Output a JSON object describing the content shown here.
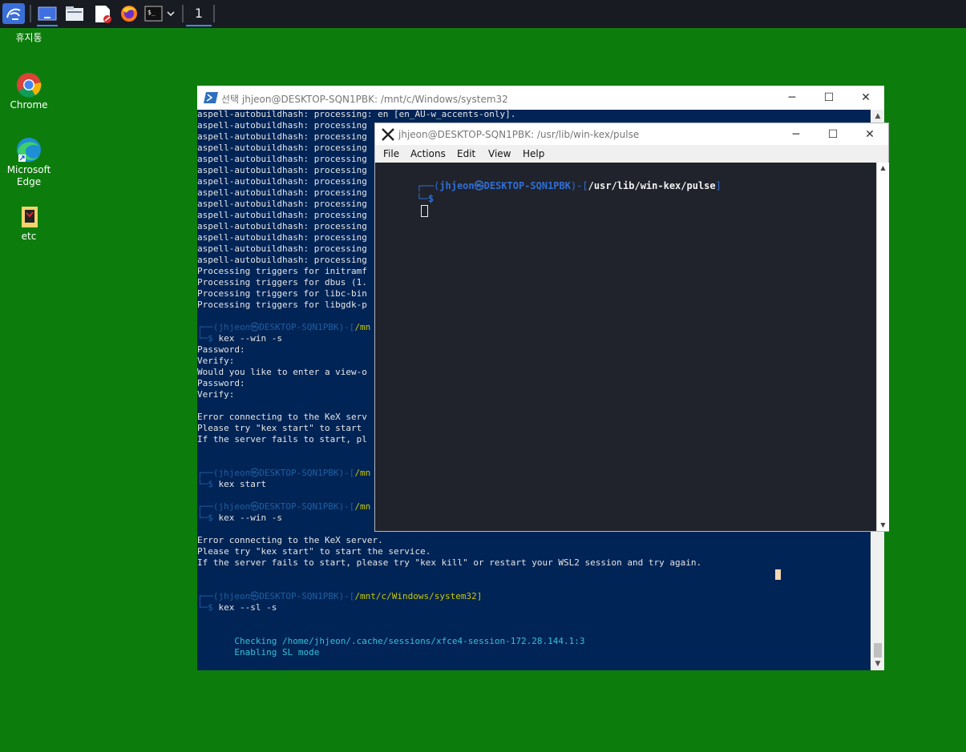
{
  "taskbar": {
    "workspace_number": "1",
    "icons": [
      "kali-menu-icon",
      "desktop-icon",
      "file-manager-icon",
      "text-editor-icon",
      "firefox-icon",
      "terminal-icon"
    ]
  },
  "desktop": {
    "items": [
      {
        "name": "trash",
        "label": "휴지통"
      },
      {
        "name": "chrome",
        "label": "Chrome"
      },
      {
        "name": "edge",
        "label": "Microsoft\nEdge"
      },
      {
        "name": "etc",
        "label": "etc"
      }
    ]
  },
  "ps_window": {
    "title": "선택 jhjeon@DESKTOP-SQN1PBK: /mnt/c/Windows/system32",
    "lines": [
      {
        "t": "aspell-autobuildhash: processing: en [en_AU-w_accents-only]."
      },
      {
        "t": "aspell-autobuildhash: processing"
      },
      {
        "t": "aspell-autobuildhash: processing"
      },
      {
        "t": "aspell-autobuildhash: processing"
      },
      {
        "t": "aspell-autobuildhash: processing"
      },
      {
        "t": "aspell-autobuildhash: processing"
      },
      {
        "t": "aspell-autobuildhash: processing"
      },
      {
        "t": "aspell-autobuildhash: processing"
      },
      {
        "t": "aspell-autobuildhash: processing"
      },
      {
        "t": "aspell-autobuildhash: processing"
      },
      {
        "t": "aspell-autobuildhash: processing"
      },
      {
        "t": "aspell-autobuildhash: processing"
      },
      {
        "t": "aspell-autobuildhash: processing"
      },
      {
        "t": "aspell-autobuildhash: processing"
      },
      {
        "t": "Processing triggers for initramf"
      },
      {
        "t": "Processing triggers for dbus (1."
      },
      {
        "t": "Processing triggers for libc-bin"
      },
      {
        "t": "Processing triggers for libgdk-p"
      },
      {
        "t": ""
      },
      {
        "t": "┌──(jhjeon㉿DESKTOP-SQN1PBK)-[/mn",
        "k": "prompt"
      },
      {
        "t": "└─$ kex --win -s",
        "k": "cmd"
      },
      {
        "t": "Password:"
      },
      {
        "t": "Verify:"
      },
      {
        "t": "Would you like to enter a view-o"
      },
      {
        "t": "Password:"
      },
      {
        "t": "Verify:"
      },
      {
        "t": ""
      },
      {
        "t": "Error connecting to the KeX serv"
      },
      {
        "t": "Please try \"kex start\" to start"
      },
      {
        "t": "If the server fails to start, pl"
      },
      {
        "t": ""
      },
      {
        "t": ""
      },
      {
        "t": "┌──(jhjeon㉿DESKTOP-SQN1PBK)-[/mn",
        "k": "prompt"
      },
      {
        "t": "└─$ kex start",
        "k": "cmd"
      },
      {
        "t": ""
      },
      {
        "t": "┌──(jhjeon㉿DESKTOP-SQN1PBK)-[/mn",
        "k": "prompt"
      },
      {
        "t": "└─$ kex --win -s",
        "k": "cmd"
      },
      {
        "t": ""
      },
      {
        "t": "Error connecting to the KeX server."
      },
      {
        "t": "Please try \"kex start\" to start the service."
      },
      {
        "t": "If the server fails to start, please try \"kex kill\" or restart your WSL2 session and try again."
      },
      {
        "t": ""
      },
      {
        "t": ""
      },
      {
        "t": "┌──(jhjeon㉿DESKTOP-SQN1PBK)-[/mnt/c/Windows/system32]",
        "k": "prompt"
      },
      {
        "t": "└─$ kex --sl -s",
        "k": "cmd"
      },
      {
        "t": ""
      },
      {
        "t": ""
      },
      {
        "t": "       Checking /home/jhjeon/.cache/sessions/xfce4-session-172.28.144.1:3",
        "k": "cyan"
      },
      {
        "t": "       Enabling SL mode",
        "k": "cyan"
      }
    ]
  },
  "kex_window": {
    "title": "jhjeon@DESKTOP-SQN1PBK: /usr/lib/win-kex/pulse",
    "menu": [
      "File",
      "Actions",
      "Edit",
      "View",
      "Help"
    ],
    "prompt": {
      "open": "┌──(",
      "user": "jhjeon㉿DESKTOP-SQN1PBK",
      "mid": ")-[",
      "path": "/usr/lib/win-kex/pulse",
      "close": "]",
      "line2": "└─",
      "dollar": "$"
    }
  },
  "colors": {
    "desktop": "#0c7d0c",
    "ps_bg": "#012456",
    "kex_bg": "#20232b",
    "prompt_blue": "#2f6fd6"
  }
}
